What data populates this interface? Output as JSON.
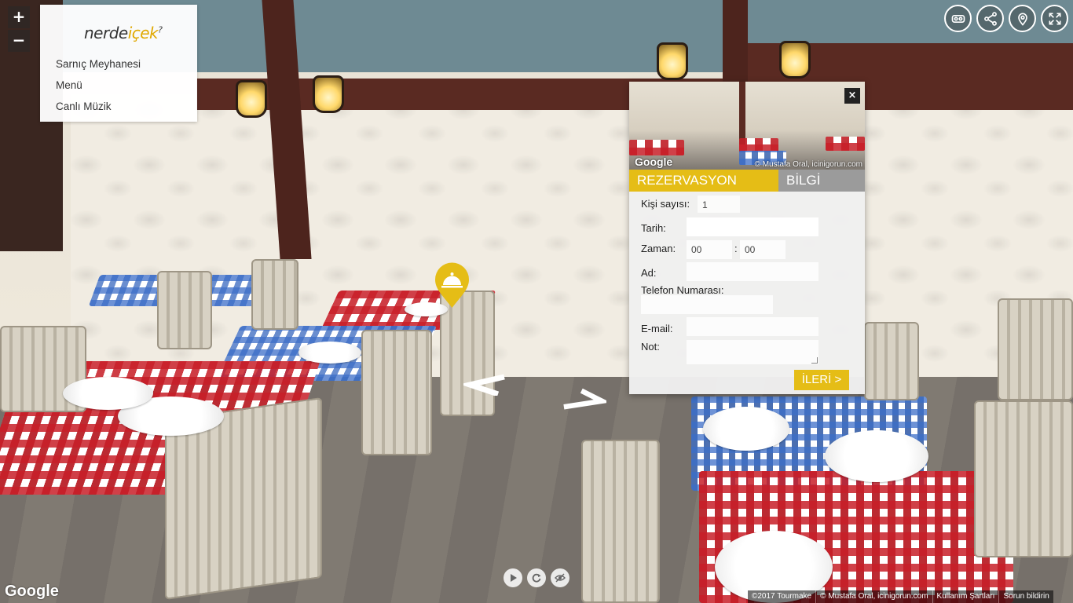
{
  "zoom": {
    "in_label": "+",
    "out_label": "−"
  },
  "menu": {
    "logo": {
      "part1": "nerde",
      "part2": "içek",
      "sup": "?"
    },
    "items": [
      {
        "label": "Sarnıç Meyhanesi"
      },
      {
        "label": "Menü"
      },
      {
        "label": "Canlı Müzik"
      }
    ]
  },
  "toolbar": {
    "buttons": [
      {
        "icon": "vr-headset-icon"
      },
      {
        "icon": "share-icon"
      },
      {
        "icon": "location-pin-icon"
      },
      {
        "icon": "fullscreen-icon"
      }
    ]
  },
  "popup": {
    "close_label": "×",
    "photo_google": "Google",
    "photo_credit": "© Mustafa Oral, icinigorun.com",
    "tabs": [
      {
        "label": "REZERVASYON",
        "active": true
      },
      {
        "label": "BİLGİ",
        "active": false
      }
    ],
    "form": {
      "people_label": "Kişi sayısı:",
      "people_value": "1",
      "date_label": "Tarih:",
      "date_value": "",
      "time_label": "Zaman:",
      "hour_value": "00",
      "time_sep": ":",
      "minute_value": "00",
      "name_label": "Ad:",
      "name_value": "",
      "phone_label": "Telefon Numarası:",
      "phone_value": "",
      "email_label": "E-mail:",
      "email_value": "",
      "note_label": "Not:",
      "note_value": ""
    },
    "next_label": "İLERİ >"
  },
  "map_pin_icon": "restaurant-cloche-icon",
  "bottom_controls": [
    {
      "icon": "play-icon"
    },
    {
      "icon": "rotate-icon"
    },
    {
      "icon": "eye-hide-icon"
    }
  ],
  "google_logo": "Google",
  "footer": {
    "copyright": "©2017 Tourmake",
    "credit": "© Mustafa Oral, icinigorun.com",
    "terms": "Kullanım Şartları",
    "report": "Sorun bildirin"
  },
  "colors": {
    "accent": "#e5bd16",
    "inactive_tab": "#9b9b9b"
  }
}
